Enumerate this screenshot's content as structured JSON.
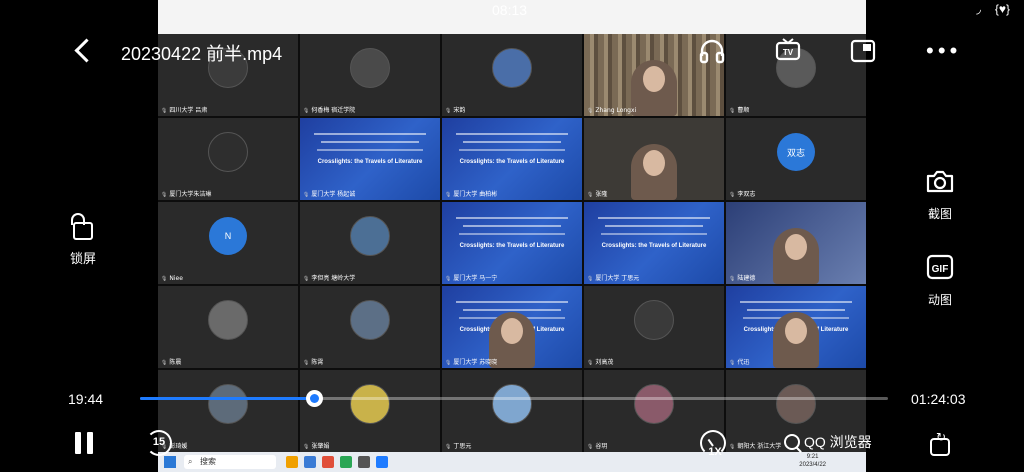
{
  "status_bar": {
    "time": "08:13",
    "wifi_icon": "wifi-icon",
    "battery_text": "{♥}"
  },
  "player": {
    "title": "20230422 前半.mp4",
    "lock_label": "锁屏",
    "screenshot_label": "截图",
    "gif_label": "动图",
    "gif_icon_text": "GIF",
    "tv_icon_text": "TV",
    "current_time": "19:44",
    "total_time": "01:24:03",
    "progress": 0.233,
    "skip_seconds": "15",
    "speed": "1X",
    "brand": "QQ 浏览器",
    "thumb_time": "19:44"
  },
  "meeting": {
    "tiles": [
      {
        "name": "四川大学 吕肃",
        "kind": "photo-dark"
      },
      {
        "name": "何香梅 宿迁学院",
        "kind": "photo-face"
      },
      {
        "name": "宋韵",
        "kind": "photo-blue"
      },
      {
        "name": "Zhang Longxi",
        "kind": "video-books"
      },
      {
        "name": "曹顺",
        "kind": "photo-gray"
      },
      {
        "name": "厦门大学朱洁琳",
        "kind": "photo-panda"
      },
      {
        "name": "厦门大学 杨起诚",
        "kind": "slide"
      },
      {
        "name": "厦门大学 曲柏彬",
        "kind": "slide"
      },
      {
        "name": "张隆",
        "kind": "video-person"
      },
      {
        "name": "李双志",
        "kind": "avatar-blue",
        "initial": "双志"
      },
      {
        "name": "Niee",
        "kind": "avatar-blue",
        "initial": "N"
      },
      {
        "name": "李但亮 塘岭大学",
        "kind": "photo-sky"
      },
      {
        "name": "厦门大学 马一宁",
        "kind": "slide"
      },
      {
        "name": "厦门大学 丁思元",
        "kind": "slide"
      },
      {
        "name": "陆建德",
        "kind": "video-slide-person"
      },
      {
        "name": "陈晨",
        "kind": "photo-bird"
      },
      {
        "name": "陈霄",
        "kind": "photo-city"
      },
      {
        "name": "厦门大学 苏晓晓",
        "kind": "slide-person"
      },
      {
        "name": "刘高茂",
        "kind": "photo-cat"
      },
      {
        "name": "代迅",
        "kind": "slide-person"
      },
      {
        "name": "彭琦媛",
        "kind": "photo-street"
      },
      {
        "name": "张肇娟",
        "kind": "photo-yellow"
      },
      {
        "name": "丁思元",
        "kind": "photo-sea"
      },
      {
        "name": "谷玥",
        "kind": "photo-flower"
      },
      {
        "name": "朝阳大 浙江大学",
        "kind": "photo-avatar"
      }
    ],
    "slide_caption": "Crosslights: the Travels of Literature"
  },
  "taskbar": {
    "search_placeholder": "搜索",
    "clock_time": "9:21",
    "clock_date": "2023/4/22"
  },
  "colors": {
    "accent": "#1e7bff",
    "slide_blue": "#2f62c9"
  }
}
